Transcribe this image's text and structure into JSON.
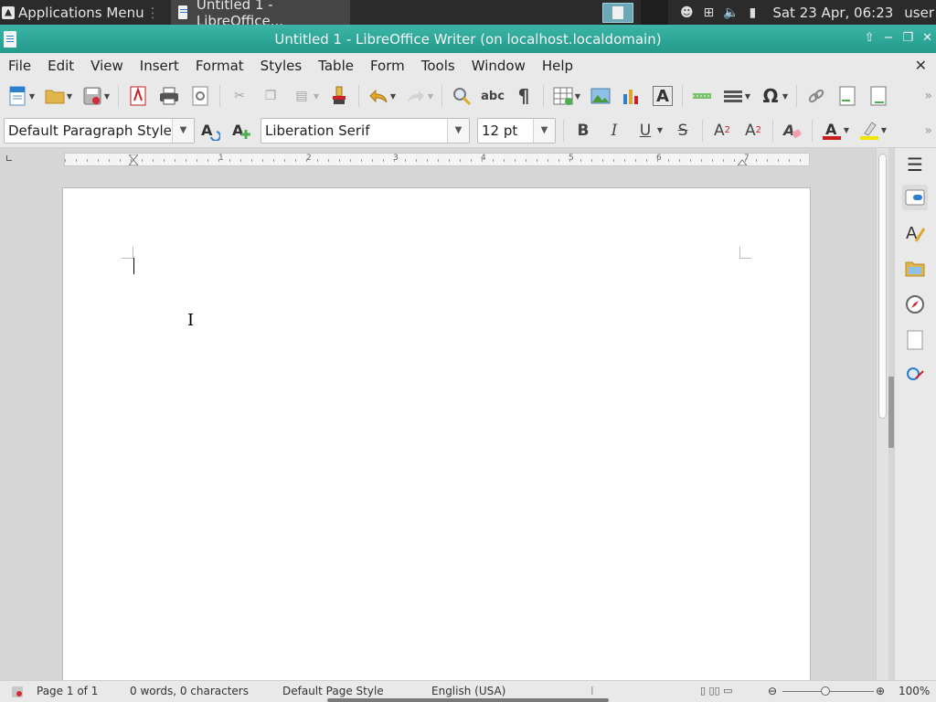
{
  "panel": {
    "apps_menu": "Applications Menu",
    "task_title": "Untitled 1 - LibreOffice...",
    "clock": "Sat 23 Apr, 06:23",
    "user": "user"
  },
  "window": {
    "title": "Untitled 1 - LibreOffice Writer (on localhost.localdomain)",
    "controls": [
      "⇧",
      "−",
      "❐",
      "✕"
    ]
  },
  "menu": {
    "items": [
      "File",
      "Edit",
      "View",
      "Insert",
      "Format",
      "Styles",
      "Table",
      "Form",
      "Tools",
      "Window",
      "Help"
    ],
    "close": "✕"
  },
  "format_bar": {
    "paragraph_style": "Default Paragraph Style",
    "font_name": "Liberation Serif",
    "font_size": "12 pt",
    "bold": "B",
    "italic": "I",
    "underline": "U",
    "strike": "S",
    "superscript": "A",
    "subscript": "A",
    "sup_mark": "2",
    "sub_mark": "2"
  },
  "toolbar": {
    "spelling": "abc",
    "formatting_marks": "¶",
    "special_char": "Ω",
    "fontwork": "A"
  },
  "ruler": {
    "numbers": [
      "1",
      "2",
      "3",
      "4",
      "5",
      "6",
      "7"
    ]
  },
  "document": {
    "ibeam": "I"
  },
  "status": {
    "page": "Page 1 of 1",
    "words": "0 words, 0 characters",
    "page_style": "Default Page Style",
    "language": "English (USA)",
    "zoom": "100%"
  },
  "colors": {
    "titlebar": "#2aa496",
    "font_color": "#c81e1e",
    "highlight": "#f2e600",
    "accent_blue": "#2b7fd0"
  }
}
